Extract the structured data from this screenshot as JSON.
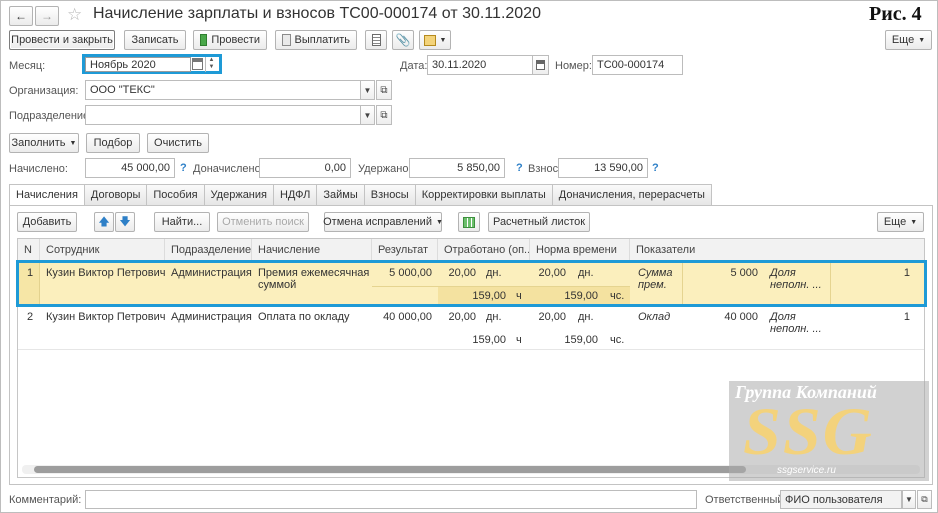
{
  "title": "Начисление зарплаты и взносов ТС00-000174 от 30.11.2020",
  "figure_label": "Рис. 4",
  "toolbar": {
    "post_close": "Провести и закрыть",
    "save": "Записать",
    "post": "Провести",
    "pay": "Выплатить",
    "more": "Еще"
  },
  "header": {
    "month_label": "Месяц:",
    "month_value": "Ноябрь 2020",
    "date_label": "Дата:",
    "date_value": "30.11.2020",
    "number_label": "Номер:",
    "number_value": "ТС00-000174",
    "org_label": "Организация:",
    "org_value": "ООО \"ТЕКС\"",
    "dept_label": "Подразделение:",
    "dept_value": ""
  },
  "actions": {
    "fill": "Заполнить",
    "select": "Подбор",
    "clear": "Очистить"
  },
  "totals": {
    "accrued_label": "Начислено:",
    "accrued_value": "45 000,00",
    "additional_label": "Доначислено:",
    "additional_value": "0,00",
    "withheld_label": "Удержано:",
    "withheld_value": "5 850,00",
    "contrib_label": "Взносы:",
    "contrib_value": "13 590,00",
    "help": "?"
  },
  "tabs": [
    "Начисления",
    "Договоры",
    "Пособия",
    "Удержания",
    "НДФЛ",
    "Займы",
    "Взносы",
    "Корректировки выплаты",
    "Доначисления, перерасчеты"
  ],
  "grid_toolbar": {
    "add": "Добавить",
    "find": "Найти...",
    "cancel_search": "Отменить поиск",
    "cancel_corrections": "Отмена исправлений",
    "payslip": "Расчетный листок",
    "more": "Еще"
  },
  "columns": [
    "N",
    "Сотрудник",
    "Подразделение",
    "Начисление",
    "Результат",
    "Отработано (оп...",
    "Норма времени",
    "Показатели"
  ],
  "rows": [
    {
      "n": "1",
      "employee": "Кузин Виктор Петрович",
      "dept": "Администрация",
      "accrual": "Премия ежемесячная",
      "accrual2": "суммой",
      "result": "5 000,00",
      "worked_days": "20,00",
      "worked_days_unit": "дн.",
      "worked_hours": "159,00",
      "worked_hours_unit": "ч",
      "norm_days": "20,00",
      "norm_days_unit": "дн.",
      "norm_hours": "159,00",
      "norm_hours_unit": "чс.",
      "ind1_name": "Сумма",
      "ind1_name2": "прем.",
      "ind1_value": "5 000",
      "ind2_name": "Доля",
      "ind2_name2": "неполн. ...",
      "ind2_value": "1"
    },
    {
      "n": "2",
      "employee": "Кузин Виктор Петрович",
      "dept": "Администрация",
      "accrual": "Оплата по окладу",
      "accrual2": "",
      "result": "40 000,00",
      "worked_days": "20,00",
      "worked_days_unit": "дн.",
      "worked_hours": "159,00",
      "worked_hours_unit": "ч",
      "norm_days": "20,00",
      "norm_days_unit": "дн.",
      "norm_hours": "159,00",
      "norm_hours_unit": "чс.",
      "ind1_name": "Оклад",
      "ind1_name2": "",
      "ind1_value": "40 000",
      "ind2_name": "Доля",
      "ind2_name2": "неполн. ...",
      "ind2_value": "1"
    }
  ],
  "footer": {
    "comment_label": "Комментарий:",
    "comment_value": "",
    "responsible_label": "Ответственный:",
    "responsible_value": "ФИО пользователя"
  },
  "watermark": {
    "line1": "Группа Компаний",
    "logo": "SSG",
    "site": "ssgservice.ru"
  },
  "colors": {
    "highlight_border": "#1e9ad6",
    "selected_row": "#fbefbd",
    "help_blue": "#2d7fc7"
  }
}
